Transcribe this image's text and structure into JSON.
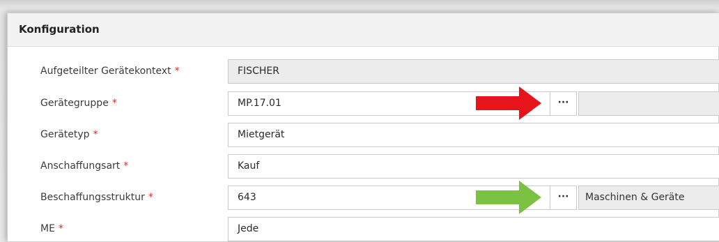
{
  "panel": {
    "title": "Konfiguration"
  },
  "fields": [
    {
      "label": "Aufgeteilter Gerätekontext",
      "required_mark": "*",
      "value": "FISCHER"
    },
    {
      "label": "Gerätegruppe",
      "required_mark": "*",
      "value": "MP.17.01",
      "lookup_label": "···",
      "description": ""
    },
    {
      "label": "Gerätetyp",
      "required_mark": "*",
      "value": "Mietgerät"
    },
    {
      "label": "Anschaffungsart",
      "required_mark": "*",
      "value": "Kauf"
    },
    {
      "label": "Beschaffungsstruktur",
      "required_mark": "*",
      "value": "643",
      "lookup_label": "···",
      "description": "Maschinen & Geräte"
    },
    {
      "label": "ME",
      "required_mark": "*",
      "value": "Jede"
    }
  ],
  "annotations": {
    "red_arrow_color": "#e8141c",
    "green_arrow_color": "#7cc242"
  },
  "colors": {
    "required": "#d62b2b",
    "readonly_bg": "#ececec",
    "header_bg": "#f2f2f2"
  }
}
